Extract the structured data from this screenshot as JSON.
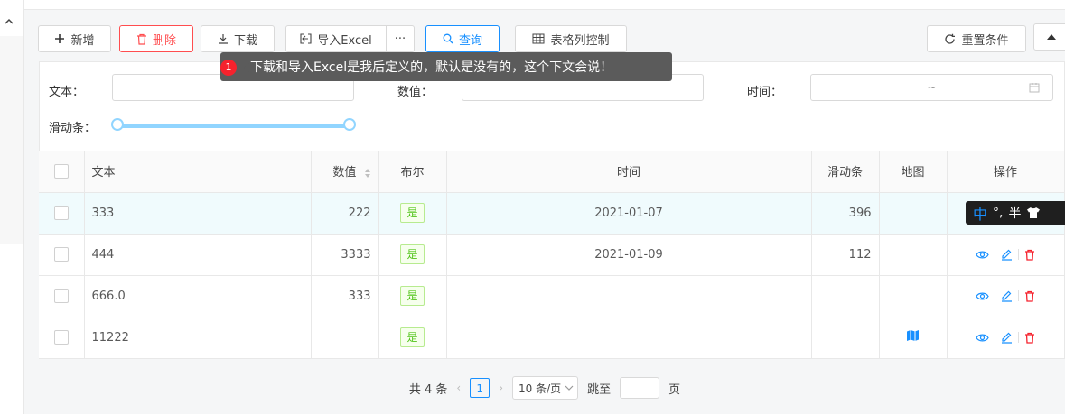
{
  "toolbar": {
    "add_label": "新增",
    "delete_label": "删除",
    "download_label": "下载",
    "import_label": "导入Excel",
    "more_label": "···",
    "query_label": "查询",
    "columns_label": "表格列控制",
    "reset_label": "重置条件"
  },
  "tooltip": {
    "badge": "1",
    "text": "下载和导入Excel是我后定义的，默认是没有的，这个下文会说！"
  },
  "filters": {
    "text_label": "文本：",
    "number_label": "数值：",
    "time_label": "时间：",
    "slider_label": "滑动条：",
    "date_sep": "~"
  },
  "table": {
    "headers": [
      "文本",
      "数值",
      "布尔",
      "时间",
      "滑动条",
      "地图",
      "操作"
    ],
    "rows": [
      {
        "text": "333",
        "number": "222",
        "bool": "是",
        "time": "2021-01-07",
        "slider": "396",
        "map": ""
      },
      {
        "text": "444",
        "number": "3333",
        "bool": "是",
        "time": "2021-01-09",
        "slider": "112",
        "map": ""
      },
      {
        "text": "666.0",
        "number": "333",
        "bool": "是",
        "time": "",
        "slider": "",
        "map": ""
      },
      {
        "text": "11222",
        "number": "",
        "bool": "是",
        "time": "",
        "slider": "",
        "map": "map-icon"
      }
    ]
  },
  "ime": {
    "lang": "中",
    "punct": "°,",
    "width": "半"
  },
  "pagination": {
    "total": "共 4 条",
    "current_page": "1",
    "page_size": "10 条/页",
    "jump_label": "跳至",
    "page_label": "页"
  },
  "colors": {
    "primary": "#1890ff",
    "danger": "#ff4d4f",
    "success": "#52c41a"
  }
}
